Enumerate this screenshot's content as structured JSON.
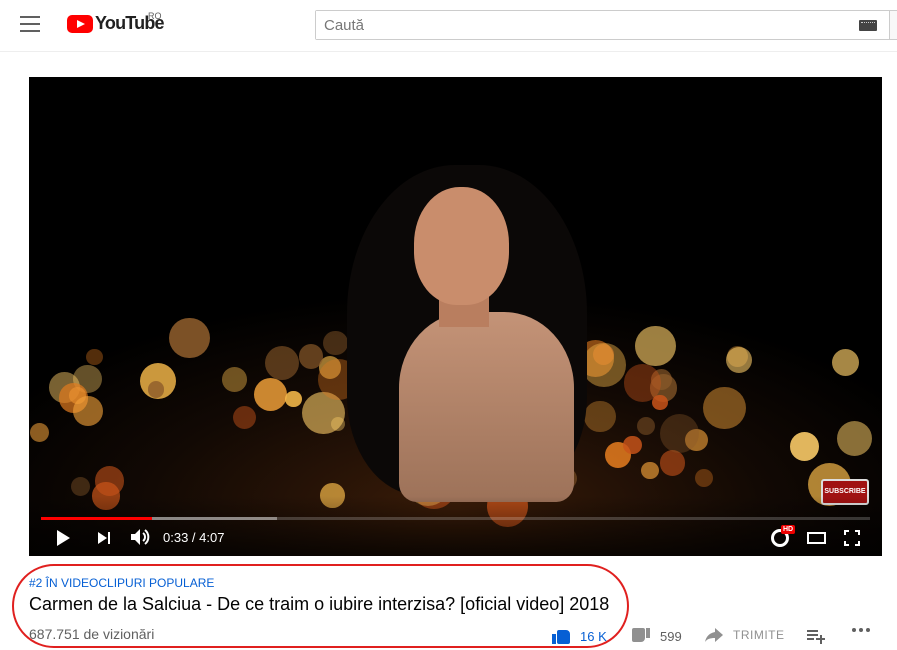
{
  "header": {
    "logo_text": "YouTube",
    "country_code": "RO",
    "search_placeholder": "Caută"
  },
  "player": {
    "current_time": "0:33",
    "duration": "4:07",
    "time_display": "0:33 / 4:07",
    "progress_played_fraction": 0.134,
    "progress_buffered_fraction": 0.285,
    "hd_badge": "HD",
    "subscribe_label": "SUBSCRIBE"
  },
  "video": {
    "hashtag": "#2 ÎN VIDEOCLIPURI POPULARE",
    "title": "Carmen de la Salciua - De ce traim o iubire interzisa? [oficial video] 2018",
    "views": "687.751 de vizionări",
    "likes": "16 K",
    "dislikes": "599",
    "share_label": "TRIMITE"
  },
  "colors": {
    "brand_red": "#ff0000",
    "link_blue": "#065fd4",
    "annotation_red": "#e0201f"
  }
}
